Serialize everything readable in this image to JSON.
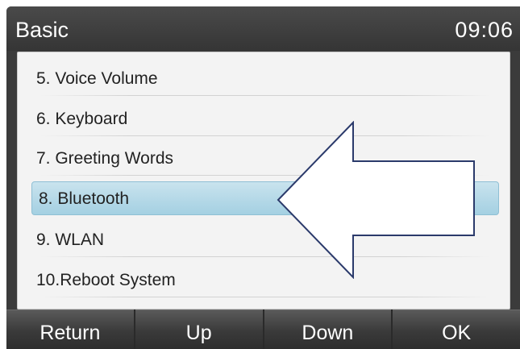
{
  "header": {
    "title": "Basic",
    "time": "09:06"
  },
  "menu": {
    "items": [
      {
        "label": "5. Voice Volume"
      },
      {
        "label": "6. Keyboard"
      },
      {
        "label": "7. Greeting Words"
      },
      {
        "label": "8. Bluetooth",
        "selected": true
      },
      {
        "label": "9. WLAN"
      },
      {
        "label": "10.Reboot System"
      }
    ]
  },
  "softkeys": {
    "return": "Return",
    "up": "Up",
    "down": "Down",
    "ok": "OK"
  },
  "colors": {
    "selection": "#a4d0e2",
    "titlebar": "#3b3b3b"
  }
}
